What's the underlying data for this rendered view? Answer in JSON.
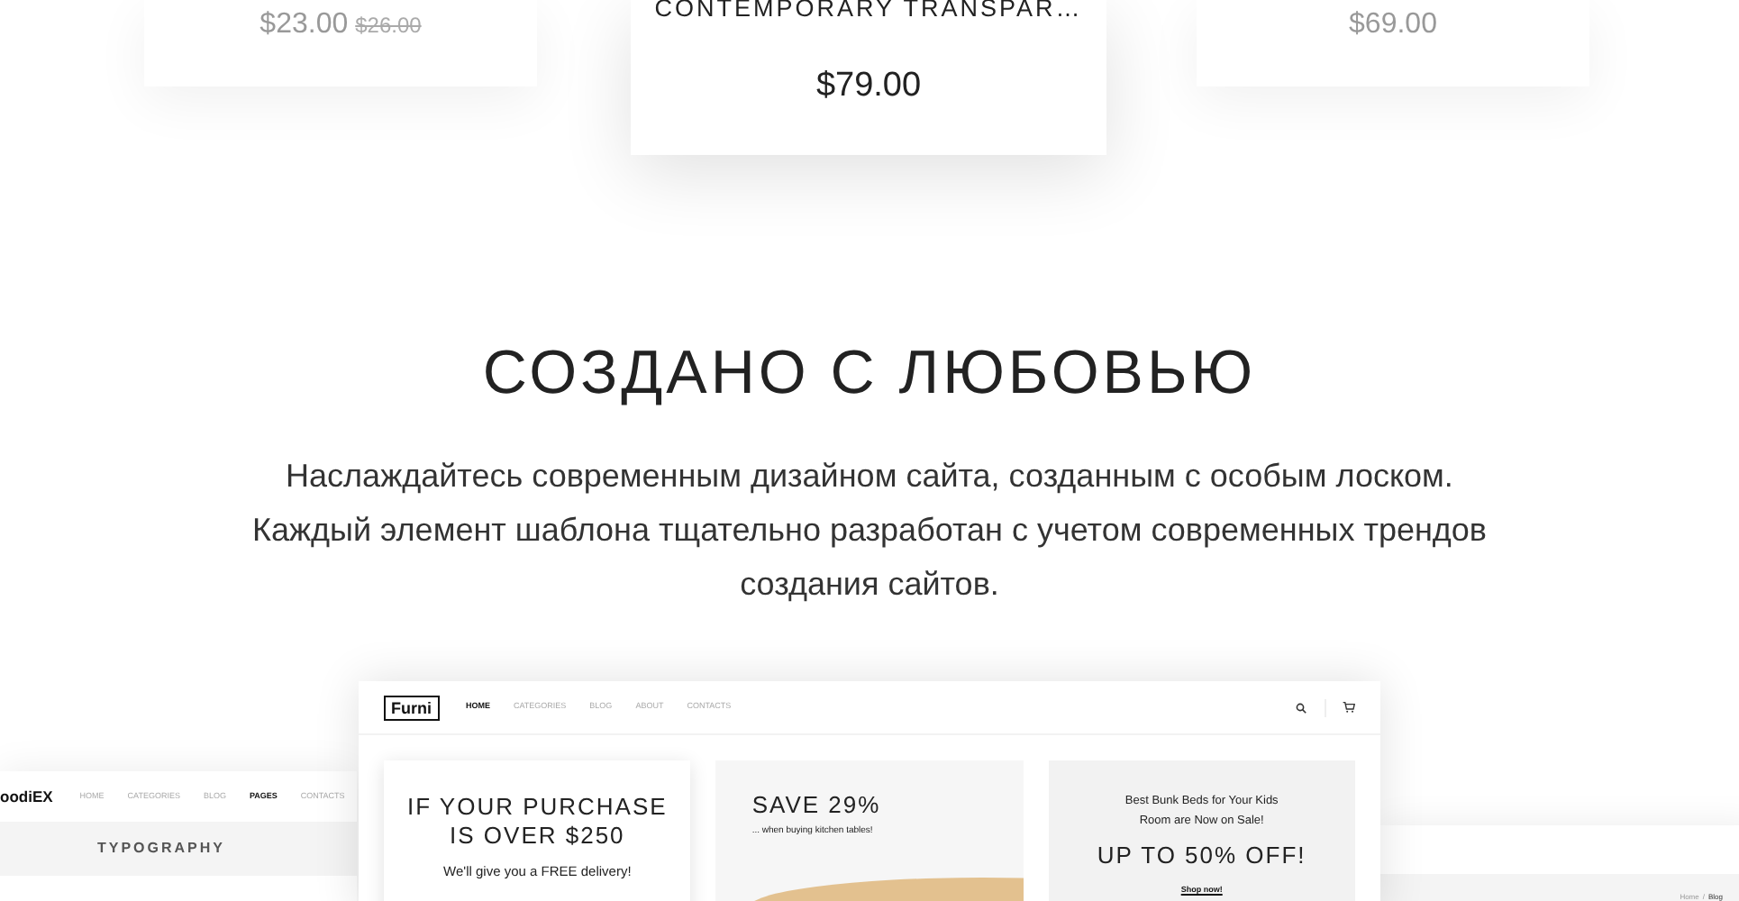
{
  "products": [
    {
      "featured": false,
      "price": "$23.00",
      "old_price": "$26.00"
    },
    {
      "featured": true,
      "title": "CONTEMPORARY TRANSPAR…",
      "price": "$79.00"
    },
    {
      "featured": false,
      "price": "$69.00"
    }
  ],
  "section": {
    "heading": "СОЗДАНО С ЛЮБОВЬЮ",
    "lines": [
      "Наслаждайтесь современным дизайном сайта, созданным с особым лоском.",
      "Каждый элемент шаблона тщательно разработан с учетом современных трендов",
      "создания сайтов."
    ]
  },
  "left_preview": {
    "logo": "oodiEX",
    "nav": [
      {
        "label": "HOME",
        "selected": false
      },
      {
        "label": "CATEGORIES",
        "selected": false
      },
      {
        "label": "BLOG",
        "selected": false
      },
      {
        "label": "PAGES",
        "selected": true
      },
      {
        "label": "CONTACTS",
        "selected": false
      }
    ],
    "page_title": "TYPOGRAPHY"
  },
  "center_preview": {
    "logo": "Furni",
    "nav": [
      {
        "label": "HOME",
        "selected": true
      },
      {
        "label": "CATEGORIES",
        "selected": false
      },
      {
        "label": "BLOG",
        "selected": false
      },
      {
        "label": "ABOUT",
        "selected": false
      },
      {
        "label": "CONTACTS",
        "selected": false
      }
    ],
    "promos": [
      {
        "kind": "delivery",
        "title_lines": [
          "IF YOUR PURCHASE",
          "IS OVER $250"
        ],
        "text": "We'll give you a FREE delivery!"
      },
      {
        "kind": "table",
        "title_lines": [
          "SAVE 29%"
        ],
        "text": "... when buying kitchen tables!"
      },
      {
        "kind": "sale",
        "intro_lines": [
          "Best Bunk Beds for Your Kids",
          "Room are Now on Sale!"
        ],
        "title_lines": [
          "UP TO 50% OFF!"
        ],
        "link": "Shop now!"
      }
    ]
  },
  "right_preview": {
    "breadcrumb": [
      {
        "label": "Home",
        "selected": false
      },
      {
        "label": "Blog",
        "selected": true
      }
    ],
    "separator": "/"
  }
}
